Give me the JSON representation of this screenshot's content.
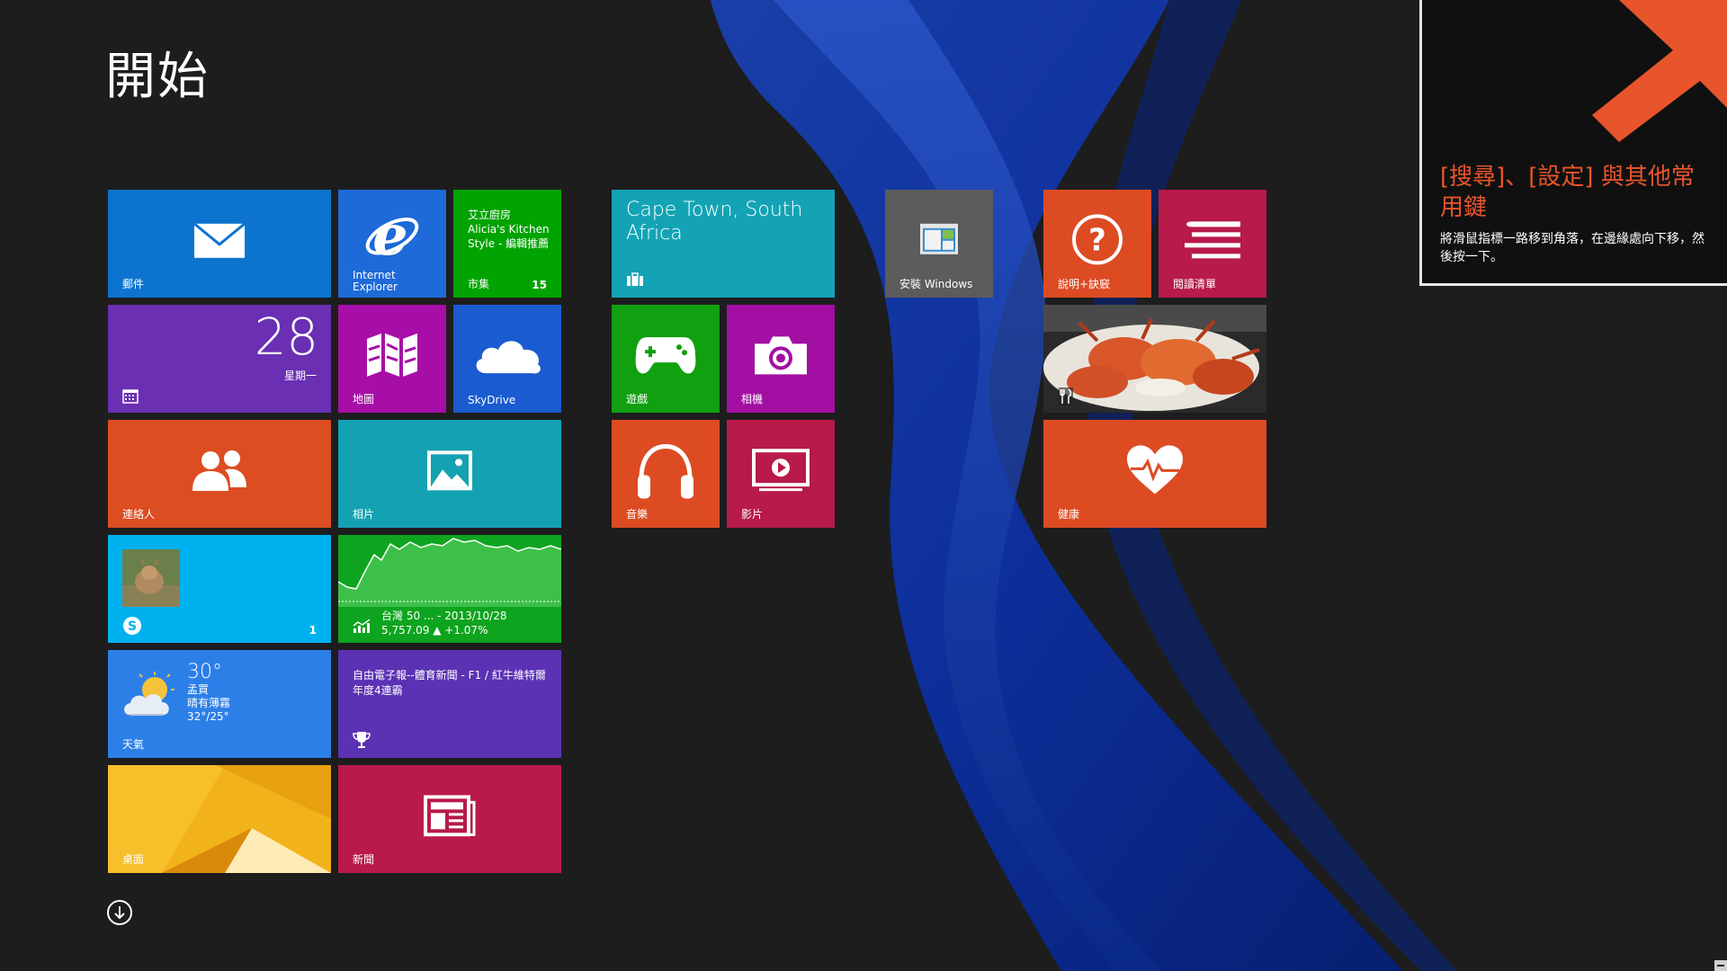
{
  "start": {
    "title": "開始"
  },
  "colors": {
    "mail": "#0c74cf",
    "ie": "#1e6ad8",
    "store": "#00a300",
    "travel": "#13a3b5",
    "calendar": "#6a2fb3",
    "maps": "#a70ea7",
    "skydrive": "#1a5bd0",
    "people": "#dc4d22",
    "photos": "#14a2b2",
    "skype": "#00b1ef",
    "finance": "#0ea41f",
    "weather": "#2d7fe8",
    "sports": "#5b32b3",
    "desktop": "#f2b31a",
    "news": "#b81a4a",
    "games": "#10a010",
    "camera": "#a30fa3",
    "music": "#dd4b23",
    "video": "#b81a4a",
    "install": "#5c5c5c",
    "help": "#dd4b23",
    "reading": "#b81a4a",
    "health": "#dd4b23",
    "accent": "#e8552c"
  },
  "tiles": {
    "mail": {
      "label": "郵件",
      "icon": "mail-icon"
    },
    "ie": {
      "label1": "Internet",
      "label2": "Explorer",
      "icon": "internet-explorer-icon"
    },
    "store": {
      "line1": "艾立廚房",
      "line2": "Alicia's Kitchen",
      "line3": "Style - 編輯推薦",
      "label": "市集",
      "badge": "15"
    },
    "calendar": {
      "day": "28",
      "weekday": "星期一",
      "icon": "calendar-icon"
    },
    "maps": {
      "label": "地圖",
      "icon": "maps-icon"
    },
    "skydrive": {
      "label": "SkyDrive",
      "icon": "cloud-icon"
    },
    "people": {
      "label": "連絡人",
      "icon": "people-icon"
    },
    "photos": {
      "label": "相片",
      "icon": "photos-icon"
    },
    "skype": {
      "badge": "1",
      "icon": "skype-icon"
    },
    "finance": {
      "line1": "台灣 50 ... - 2013/10/28",
      "line2": "5,757.09 ▲ +1.07%",
      "icon": "finance-chart-icon"
    },
    "weather": {
      "temp": "30°",
      "city": "孟買",
      "condition": "晴有薄霧",
      "range": "32°/25°",
      "label": "天氣",
      "icon": "weather-icon"
    },
    "sports": {
      "headline": "自由電子報--體育新聞 - F1 / 紅牛維特爾 年度4連霸",
      "icon": "trophy-icon"
    },
    "desktop": {
      "label": "桌面"
    },
    "news": {
      "label": "新聞",
      "icon": "news-icon"
    },
    "travel": {
      "line1": "Cape Town, South",
      "line2": "Africa",
      "icon": "suitcase-icon"
    },
    "games": {
      "label": "遊戲",
      "icon": "gamepad-icon"
    },
    "camera": {
      "label": "相機",
      "icon": "camera-icon"
    },
    "music": {
      "label": "音樂",
      "icon": "headphones-icon"
    },
    "video": {
      "label": "影片",
      "icon": "video-icon"
    },
    "install": {
      "label": "安裝 Windows",
      "icon": "install-windows-icon"
    },
    "help": {
      "label": "說明+訣竅",
      "icon": "help-icon"
    },
    "reading": {
      "label": "閱讀清單",
      "icon": "reading-list-icon"
    },
    "food": {
      "icon": "fork-knife-icon"
    },
    "health": {
      "label": "健康",
      "icon": "heart-pulse-icon"
    }
  },
  "tip": {
    "title": "[搜尋]、[設定] 與其他常用鍵",
    "body": "將滑鼠指標一路移到角落，在邊緣處向下移，然後按一下。"
  }
}
